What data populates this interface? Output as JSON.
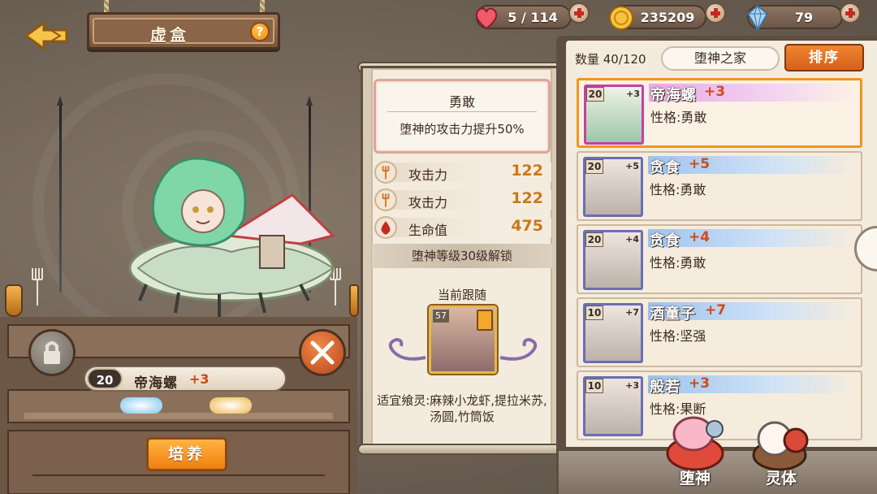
{
  "header": {
    "title": "虚盒",
    "help_label": "?"
  },
  "resources": [
    {
      "icon": "heart-icon",
      "value": "5 / 114"
    },
    {
      "icon": "gold-coin-icon",
      "value": "235209"
    },
    {
      "icon": "crystal-icon",
      "value": "79"
    }
  ],
  "hero": {
    "level": "20",
    "name": "帝海螺",
    "plus": "+3",
    "train_label": "培养"
  },
  "detail": {
    "trait_title": "勇敢",
    "trait_desc": "堕神的攻击力提升50%",
    "stats": [
      {
        "icon": "fork-icon",
        "label": "攻击力",
        "value": "122"
      },
      {
        "icon": "fork-icon",
        "label": "攻击力",
        "value": "122"
      },
      {
        "icon": "blood-drop-icon",
        "label": "生命值",
        "value": "475"
      }
    ],
    "unlock": "堕神等级30级解锁",
    "follow_title": "当前跟随",
    "follow_level": "57",
    "suitable": "适宜飨灵:麻辣小龙虾,提拉米苏,汤圆,竹筒饭"
  },
  "list": {
    "count": "数量 40/120",
    "home": "堕神之家",
    "sort_label": "排序",
    "items": [
      {
        "level": "20",
        "stars": "+3",
        "name": "帝海螺",
        "plus": "+3",
        "trait": "性格:勇敢"
      },
      {
        "level": "20",
        "stars": "+5",
        "name": "贪食",
        "plus": "+5",
        "trait": "性格:勇敢"
      },
      {
        "level": "20",
        "stars": "+4",
        "name": "贪食",
        "plus": "+4",
        "trait": "性格:勇敢"
      },
      {
        "level": "10",
        "stars": "+7",
        "name": "酒童子",
        "plus": "+7",
        "trait": "性格:坚强"
      },
      {
        "level": "10",
        "stars": "+3",
        "name": "般若",
        "plus": "+3",
        "trait": "性格:果断"
      }
    ]
  },
  "tabs": [
    {
      "label": "堕神"
    },
    {
      "label": "灵体"
    }
  ]
}
